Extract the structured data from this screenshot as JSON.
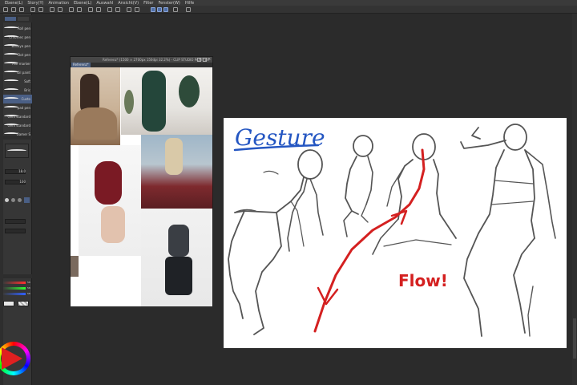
{
  "menu": [
    "Ebene(L)",
    "Story(Y)",
    "Animation",
    "Ebene(L)",
    "Auswahl",
    "Ansicht(V)",
    "Filter",
    "Fenster(W)",
    "Hilfe"
  ],
  "toolbar": {
    "reference_label": ""
  },
  "brushes": [
    {
      "name": "Roll pen",
      "selected": false
    },
    {
      "name": "Chromec pen",
      "selected": false
    },
    {
      "name": "Ballaya pen",
      "selected": false
    },
    {
      "name": "Dot pen",
      "selected": false
    },
    {
      "name": "Pen marker",
      "selected": false
    },
    {
      "name": "Oil paint",
      "selected": false
    },
    {
      "name": "Soft",
      "selected": false
    },
    {
      "name": "Bric",
      "selected": false
    },
    {
      "name": "Custo",
      "selected": true
    },
    {
      "name": "pad pen",
      "selected": false
    },
    {
      "name": "Gem standard",
      "selected": false
    },
    {
      "name": "Gem standard",
      "selected": false
    },
    {
      "name": "Gamer S",
      "selected": false
    }
  ],
  "tool_properties": {
    "brush_size": "18.0",
    "opacity": "100"
  },
  "reference_window": {
    "title": "Referenz* (1500 × 2700px 150dpi 32.2%) - CLIP STUDIO PAINT EX",
    "tab_label": "Referenz*"
  },
  "main_canvas": {
    "heading": "Gesture",
    "annotation": "Flow!",
    "ink_color": "#555555",
    "accent_color": "#d42020",
    "heading_color": "#2456c2"
  },
  "color_bars": {
    "r": "58",
    "g": "58",
    "b": "58"
  }
}
